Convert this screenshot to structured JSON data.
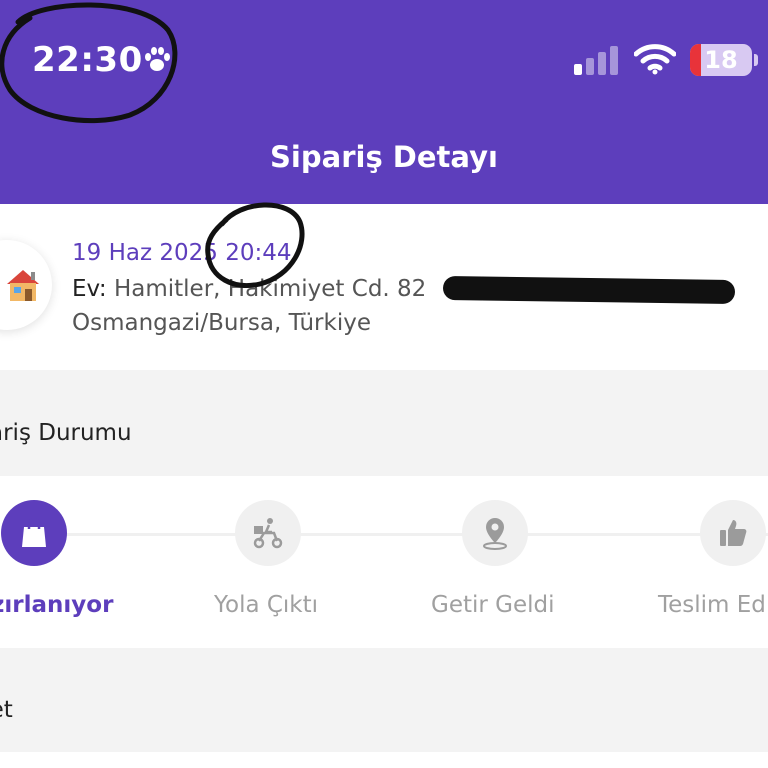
{
  "status_bar": {
    "time": "22:30",
    "battery_level": "18",
    "battery_fraction": 0.18,
    "battery_color": "#e8333a",
    "icons": [
      "paw-icon",
      "signal-icon",
      "wifi-icon",
      "battery-icon"
    ]
  },
  "header": {
    "title": "Sipariş Detayı",
    "background_color": "#5d3ebc"
  },
  "order": {
    "date": "19 Haz 2025 20:44",
    "address_label": "Ev:",
    "address_line1": "Hamitler, Hakimiyet Cd. 82",
    "address_line2": "Osmangazi/Bursa, Türkiye",
    "icon": "house-icon"
  },
  "status_section": {
    "title": "ariş Durumu",
    "steps": [
      {
        "label": "zırlanıyor",
        "icon": "shopping-bag-icon",
        "active": true
      },
      {
        "label": "Yola Çıktı",
        "icon": "courier-scooter-icon",
        "active": false
      },
      {
        "label": "Getir Geldi",
        "icon": "location-pin-icon",
        "active": false
      },
      {
        "label": "Teslim Ed",
        "icon": "thumbs-up-icon",
        "active": false
      }
    ]
  },
  "basket_section": {
    "title": "pet"
  },
  "colors": {
    "accent": "#5d3ebc",
    "inactive": "#a0a0a0",
    "page_background": "#f3f3f3"
  }
}
